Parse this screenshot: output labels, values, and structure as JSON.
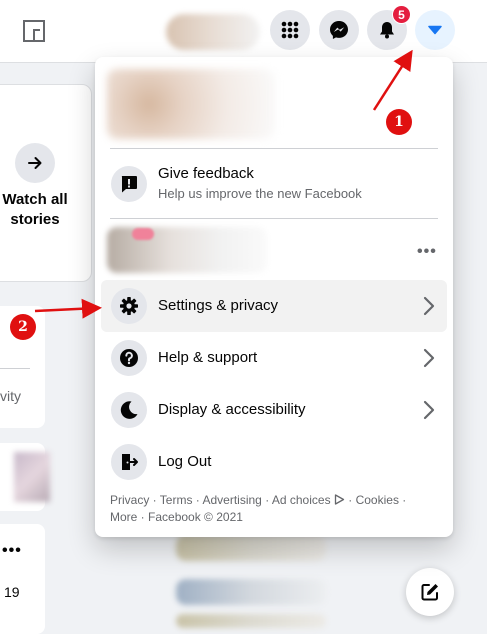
{
  "watch_all_stories": "Watch all stories",
  "left_panel": {
    "partial_text": "vity",
    "count": "19"
  },
  "header": {
    "notification_count": "5"
  },
  "menu": {
    "feedback": {
      "title": "Give feedback",
      "subtitle": "Help us improve the new Facebook"
    },
    "items": [
      {
        "label": "Settings & privacy"
      },
      {
        "label": "Help & support"
      },
      {
        "label": "Display & accessibility"
      },
      {
        "label": "Log Out"
      }
    ],
    "footer": {
      "privacy": "Privacy",
      "terms": "Terms",
      "advertising": "Advertising",
      "ad_choices": "Ad choices",
      "cookies": "Cookies",
      "more": "More",
      "copyright": "Facebook © 2021"
    }
  },
  "annotations": {
    "step1": "1",
    "step2": "2"
  },
  "colors": {
    "accent": "#1877f2",
    "badge": "#e41e3f",
    "annotation_red": "#e01010"
  },
  "icons": [
    "facebook-square-icon",
    "grid-menu-icon",
    "messenger-icon",
    "bell-icon",
    "caret-down-icon",
    "arrow-right-icon",
    "feedback-icon",
    "gear-icon",
    "question-icon",
    "moon-icon",
    "logout-icon",
    "chevron-right-icon",
    "compose-icon"
  ]
}
